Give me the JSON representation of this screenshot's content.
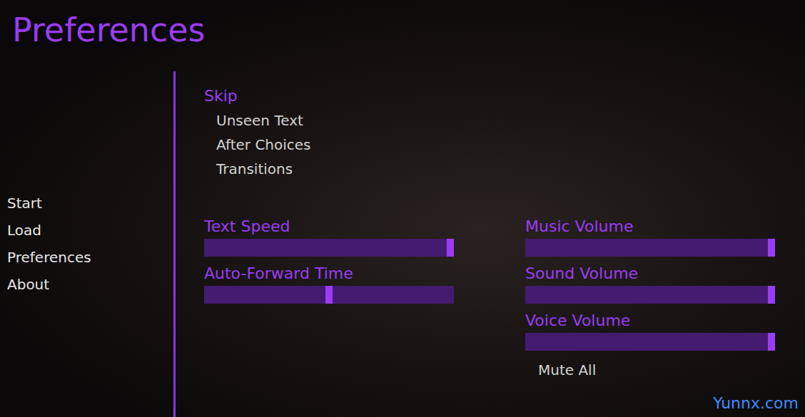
{
  "title": "Preferences",
  "nav": [
    {
      "label": "Start"
    },
    {
      "label": "Load"
    },
    {
      "label": "Preferences"
    },
    {
      "label": "About"
    }
  ],
  "skip": {
    "label": "Skip",
    "options": [
      {
        "label": "Unseen Text",
        "selected": false
      },
      {
        "label": "After Choices",
        "selected": false
      },
      {
        "label": "Transitions",
        "selected": false
      }
    ]
  },
  "sliders_left": [
    {
      "label": "Text Speed",
      "level": 1.0
    },
    {
      "label": "Auto-Forward Time",
      "level": 0.5
    }
  ],
  "sliders_right": [
    {
      "label": "Music Volume",
      "level": 1.0
    },
    {
      "label": "Sound Volume",
      "level": 1.0
    },
    {
      "label": "Voice Volume",
      "level": 1.0
    }
  ],
  "mute": {
    "label": "Mute All",
    "selected": false
  },
  "watermark": "Yunnx.com"
}
